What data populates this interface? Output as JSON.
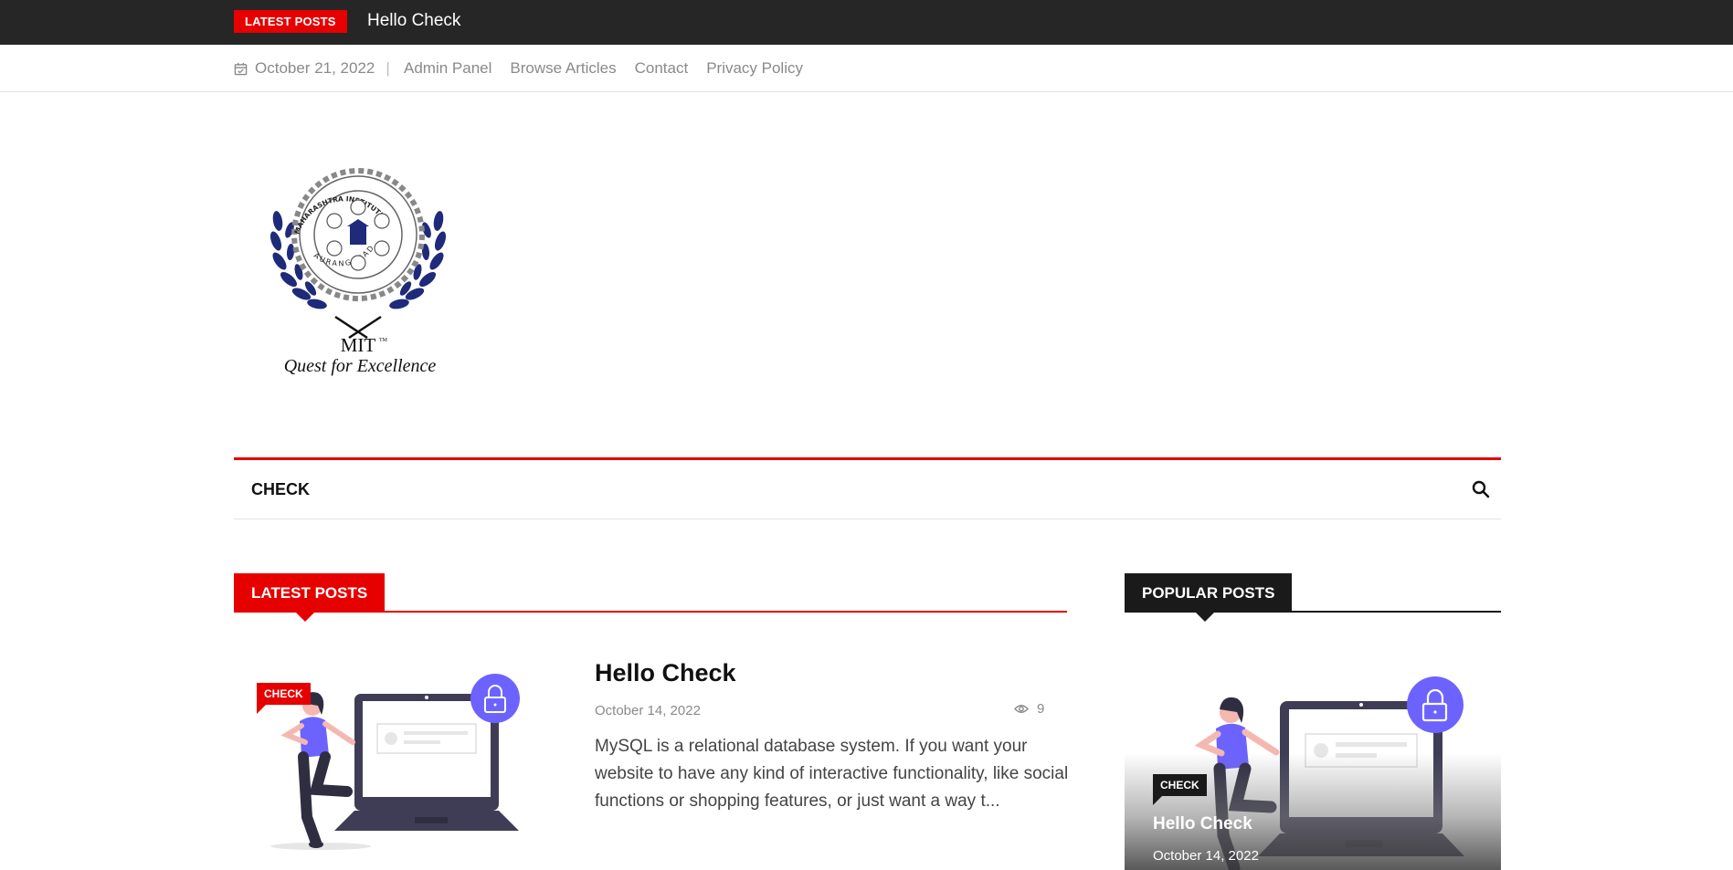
{
  "topbar": {
    "badge": "LATEST POSTS",
    "ticker": "Hello Check"
  },
  "subbar": {
    "date": "October 21, 2022",
    "links": [
      "Admin Panel",
      "Browse Articles",
      "Contact",
      "Privacy Policy"
    ]
  },
  "logo": {
    "name": "MAHARASHTRA INSTITUTE OF TECHNOLOGY",
    "city": "AURANGABAD",
    "mark": "MIT",
    "tm": "TM",
    "tagline": "Quest for Excellence"
  },
  "nav": {
    "menu_item": "CHECK",
    "search_icon": "search-icon"
  },
  "latest": {
    "heading": "LATEST POSTS",
    "post": {
      "category": "CHECK",
      "title": "Hello Check",
      "date": "October 14, 2022",
      "views": "9",
      "excerpt": "MySQL is a relational database system. If you want your website to have any kind of interactive functionality, like social functions or shopping features, or just want a way t..."
    }
  },
  "popular": {
    "heading": "POPULAR POSTS",
    "post": {
      "category": "CHECK",
      "title": "Hello Check",
      "date": "October 14, 2022"
    }
  },
  "colors": {
    "accent": "#e60000",
    "dark": "#262626",
    "illustration": "#6c63ff"
  }
}
